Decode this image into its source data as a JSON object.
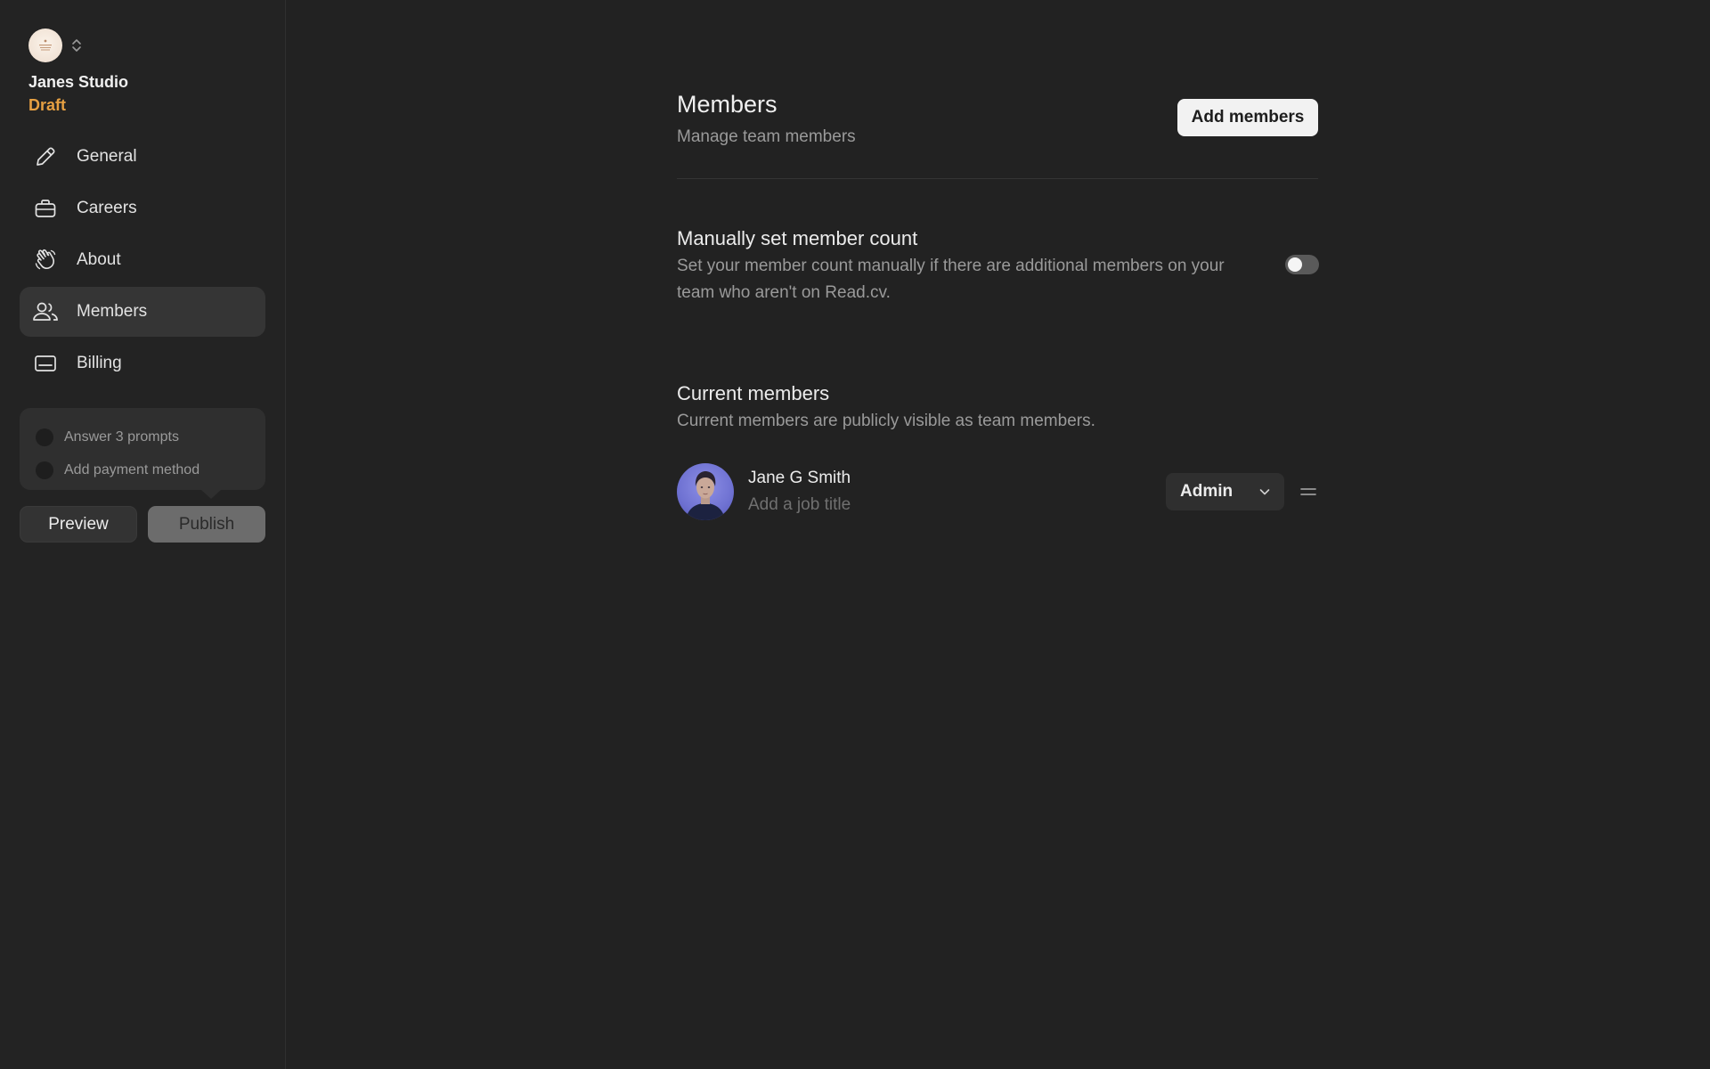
{
  "sidebar": {
    "team_name": "Janes Studio",
    "team_status": "Draft",
    "status_color": "#e6a042",
    "nav": [
      {
        "label": "General",
        "icon": "pencil-icon",
        "active": false
      },
      {
        "label": "Careers",
        "icon": "briefcase-icon",
        "active": false
      },
      {
        "label": "About",
        "icon": "waving-hand-icon",
        "active": false
      },
      {
        "label": "Members",
        "icon": "members-icon",
        "active": true
      },
      {
        "label": "Billing",
        "icon": "credit-card-icon",
        "active": false
      }
    ],
    "checklist": [
      {
        "label": "Answer 3 prompts",
        "done": false
      },
      {
        "label": "Add payment method",
        "done": false
      }
    ],
    "preview_label": "Preview",
    "publish_label": "Publish"
  },
  "main": {
    "title": "Members",
    "subtitle": "Manage team members",
    "add_button_label": "Add members",
    "manual_count": {
      "title": "Manually set member count",
      "description": "Set your member count manually if there are additional members on your team who aren't on Read.cv.",
      "enabled": false
    },
    "current_members": {
      "title": "Current members",
      "description": "Current members are publicly visible as team members.",
      "members": [
        {
          "name": "Jane G Smith",
          "job_placeholder": "Add a job title",
          "role": "Admin"
        }
      ]
    }
  }
}
